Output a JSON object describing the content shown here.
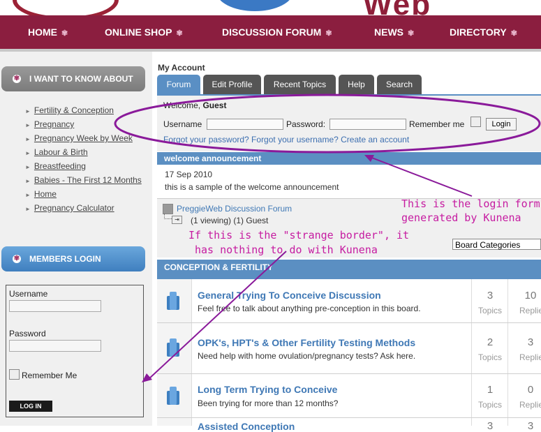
{
  "nav": [
    {
      "label": "HOME"
    },
    {
      "label": "ONLINE SHOP"
    },
    {
      "label": "DISCUSSION FORUM"
    },
    {
      "label": "NEWS"
    },
    {
      "label": "DIRECTORY"
    }
  ],
  "sidebar": {
    "know_title": "I WANT TO KNOW ABOUT",
    "know_items": [
      {
        "label": "Fertility & Conception"
      },
      {
        "label": "Pregnancy"
      },
      {
        "label": "Pregnancy Week by Week"
      },
      {
        "label": "Labour & Birth"
      },
      {
        "label": "Breastfeeding"
      },
      {
        "label": "Babies - The First 12 Months"
      },
      {
        "label": "Home"
      },
      {
        "label": "Pregnancy Calculator"
      }
    ],
    "members_title": "MEMBERS LOGIN",
    "username_label": "Username",
    "password_label": "Password",
    "remember_label": "Remember Me",
    "login_button": "LOG IN"
  },
  "main": {
    "section_title": "My Account",
    "tabs": [
      {
        "label": "Forum",
        "active": true
      },
      {
        "label": "Edit Profile"
      },
      {
        "label": "Recent Topics"
      },
      {
        "label": "Help"
      },
      {
        "label": "Search"
      }
    ],
    "login": {
      "welcome_prefix": "Welcome, ",
      "welcome_name": "Guest",
      "username_label": "Username",
      "password_label": "Password:",
      "remember_label": "Remember me",
      "login_button": "Login",
      "forgot_text": "Forgot your password? Forgot your username? Create an account"
    },
    "announcement": {
      "title": "welcome announcement",
      "date": "17 Sep 2010",
      "text": "this is a sample of the welcome announcement"
    },
    "stats": {
      "forum_name": "PreggieWeb Discussion Forum",
      "viewing": "(1 viewing) (1) Guest"
    },
    "category_select": "Board Categories",
    "category_title": "CONCEPTION & FERTILITY",
    "forums": [
      {
        "title": "General Trying To Conceive Discussion",
        "desc": "Feel free to talk about anything pre-conception in this board.",
        "topics": "3",
        "topics_label": "Topics",
        "replies": "10",
        "replies_label": "Replies"
      },
      {
        "title": "OPK's, HPT's & Other Fertility Testing Methods",
        "desc": "Need help with home ovulation/pregnancy tests? Ask here.",
        "topics": "2",
        "topics_label": "Topics",
        "replies": "3",
        "replies_label": "Replies"
      },
      {
        "title": "Long Term Trying to Conceive",
        "desc": "Been trying for more than 12 months?",
        "topics": "1",
        "topics_label": "Topics",
        "replies": "0",
        "replies_label": "Replies"
      },
      {
        "title": "Assisted Conception",
        "topics": "3",
        "replies": "3"
      }
    ]
  },
  "annotations": {
    "login_form_note_1": "This is the login form",
    "login_form_note_2": "generated by Kunena",
    "border_note_1": "If this is the \"strange border\", it",
    "border_note_2": "has nothing to do with Kunena"
  },
  "colors": {
    "nav_bg": "#8b1e3f",
    "tab_active": "#5a8fc4",
    "annotation": "#c61ca1",
    "link": "#3d6fb0"
  }
}
